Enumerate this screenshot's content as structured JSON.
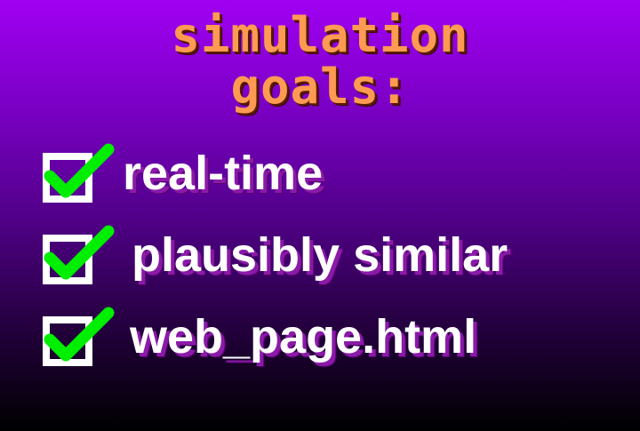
{
  "title": {
    "line1": "simulation",
    "line2": "goals:"
  },
  "goals": [
    {
      "label": "real-time",
      "checked": true
    },
    {
      "label": "plausibly similar",
      "checked": true
    },
    {
      "label": "web_page.html",
      "checked": true
    }
  ],
  "colors": {
    "title": "#ff9a52",
    "checkmark": "#00ee00",
    "text": "#ffffff",
    "gradient_top": "#a000f2",
    "gradient_bottom": "#000000"
  },
  "icons": {
    "check": "checkmark-icon",
    "box": "checkbox-icon"
  }
}
